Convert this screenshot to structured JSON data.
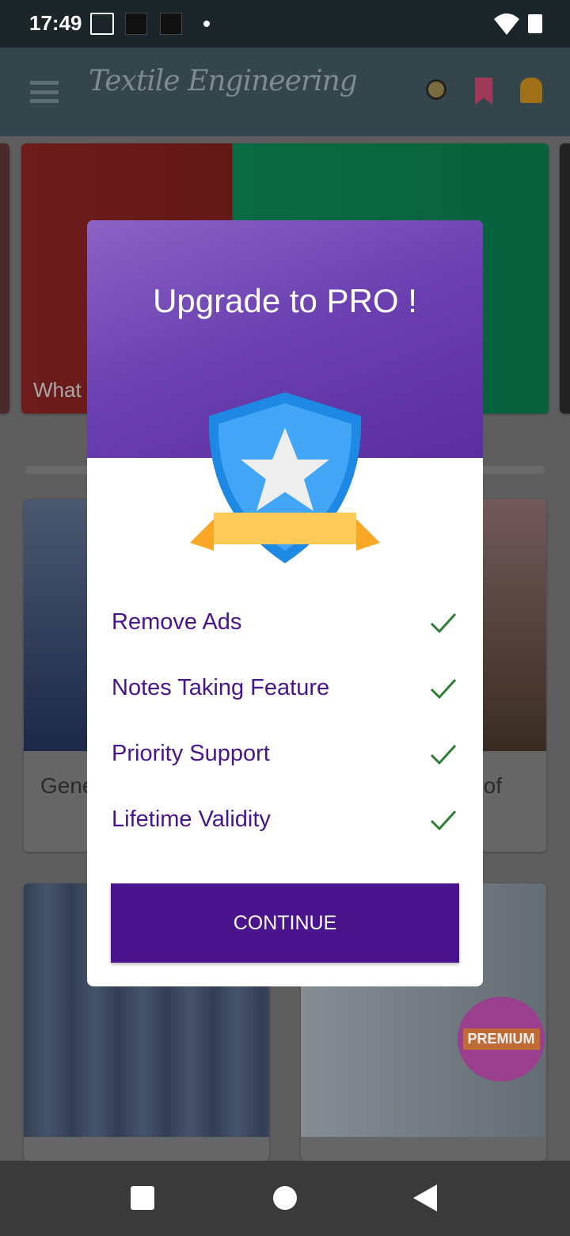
{
  "status_bar": {
    "time": "17:49",
    "icons": [
      "settings-monitor-icon",
      "chart-icon",
      "chart-icon",
      "dot-icon",
      "wifi-icon",
      "battery-icon"
    ]
  },
  "app_bar": {
    "title": "Textile Engineering",
    "icons": [
      "menu-icon",
      "search-icon",
      "bookmark-icon",
      "bell-icon"
    ]
  },
  "carousel": {
    "caption": "What"
  },
  "grid": [
    {
      "caption": "Gene"
    },
    {
      "caption": "of"
    },
    {
      "caption": ""
    },
    {
      "caption": "",
      "badge": "PREMIUM"
    }
  ],
  "dialog": {
    "title": "Upgrade to PRO !",
    "features": [
      {
        "label": "Remove Ads"
      },
      {
        "label": "Notes Taking Feature"
      },
      {
        "label": "Priority Support"
      },
      {
        "label": "Lifetime Validity"
      }
    ],
    "button": "CONTINUE",
    "colors": {
      "accent": "#4a148c",
      "check": "#2e7d32"
    }
  },
  "nav_bar": {
    "icons": [
      "recents-square-icon",
      "home-circle-icon",
      "back-triangle-icon"
    ]
  }
}
